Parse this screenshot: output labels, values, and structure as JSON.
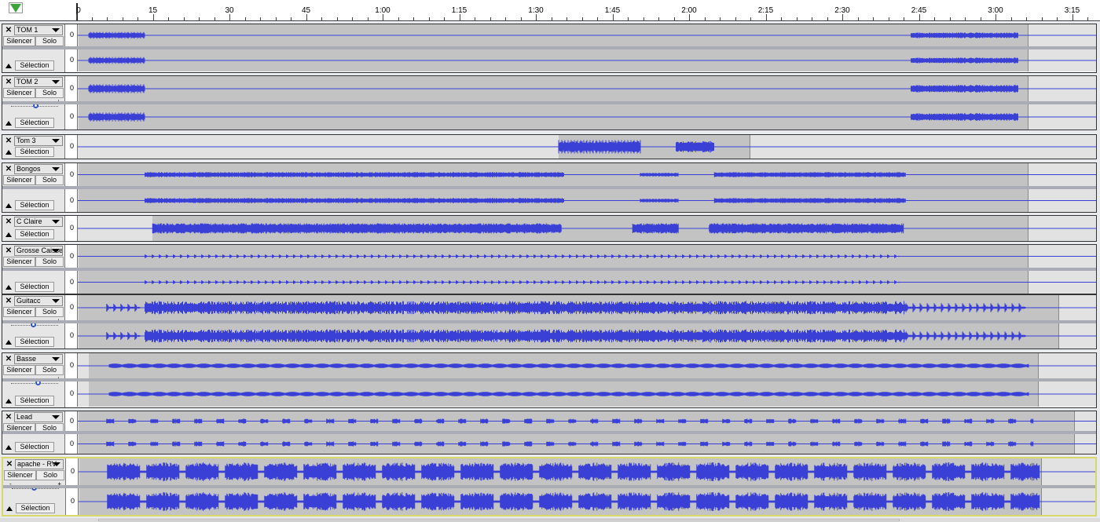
{
  "ruler": {
    "marker_icon": "play-head-triangle-icon",
    "ticks": [
      {
        "label": "0",
        "seconds": 0
      },
      {
        "label": "15",
        "seconds": 15
      },
      {
        "label": "30",
        "seconds": 30
      },
      {
        "label": "45",
        "seconds": 45
      },
      {
        "label": "1:00",
        "seconds": 60
      },
      {
        "label": "1:15",
        "seconds": 75
      },
      {
        "label": "1:30",
        "seconds": 90
      },
      {
        "label": "1:45",
        "seconds": 105
      },
      {
        "label": "2:00",
        "seconds": 120
      },
      {
        "label": "2:15",
        "seconds": 135
      },
      {
        "label": "2:30",
        "seconds": 150
      },
      {
        "label": "2:45",
        "seconds": 165
      },
      {
        "label": "3:00",
        "seconds": 180
      },
      {
        "label": "3:15",
        "seconds": 195
      }
    ]
  },
  "labels": {
    "close": "✕",
    "mute": "Silencer",
    "solo": "Solo",
    "select": "Sélection",
    "scale_zero": "0",
    "gain_minus": "-",
    "gain_plus": "+"
  },
  "colors": {
    "waveform": "#3a40d6",
    "clip_background": "#c3c3c3",
    "selected_track_border": "#d8d86a",
    "play_marker": "#3aa33a"
  },
  "tracks": [
    {
      "name": "TOM 1",
      "stereo": true,
      "has_mute_solo": true,
      "has_gain": false,
      "selected": false,
      "clip_start": 0,
      "clip_end": 186,
      "segments": [
        {
          "start": 2,
          "end": 13,
          "amp": 0.35,
          "style": "spiky"
        },
        {
          "start": 163,
          "end": 184,
          "amp": 0.35,
          "style": "spiky"
        }
      ]
    },
    {
      "name": "TOM 2",
      "stereo": true,
      "has_mute_solo": true,
      "has_gain": true,
      "gain_level": 0.5,
      "selected": false,
      "clip_start": 0,
      "clip_end": 186,
      "segments": [
        {
          "start": 2,
          "end": 13,
          "amp": 0.4,
          "style": "spiky"
        },
        {
          "start": 163,
          "end": 184,
          "amp": 0.4,
          "style": "spiky"
        }
      ]
    },
    {
      "name": "Tom 3",
      "stereo": false,
      "has_mute_solo": false,
      "has_gain": false,
      "selected": false,
      "clip_start": 94,
      "clip_end": 131.5,
      "segments": [
        {
          "start": 94,
          "end": 110,
          "amp": 0.65,
          "style": "spiky"
        },
        {
          "start": 117,
          "end": 124.5,
          "amp": 0.65,
          "style": "spiky"
        }
      ]
    },
    {
      "name": "Bongos",
      "stereo": true,
      "has_mute_solo": true,
      "has_gain": false,
      "selected": false,
      "clip_start": 0,
      "clip_end": 186,
      "segments": [
        {
          "start": 13,
          "end": 95,
          "amp": 0.3,
          "style": "spiky"
        },
        {
          "start": 110,
          "end": 117.5,
          "amp": 0.2,
          "style": "spiky"
        },
        {
          "start": 124.5,
          "end": 162,
          "amp": 0.3,
          "style": "spiky"
        }
      ]
    },
    {
      "name": "C Claire",
      "stereo": false,
      "has_mute_solo": false,
      "has_gain": false,
      "selected": false,
      "clip_start": 14.5,
      "clip_end": 186,
      "segments": [
        {
          "start": 14.5,
          "end": 94.5,
          "amp": 0.55,
          "style": "spiky"
        },
        {
          "start": 108.5,
          "end": 117.5,
          "amp": 0.55,
          "style": "spiky"
        },
        {
          "start": 123.5,
          "end": 161.5,
          "amp": 0.55,
          "style": "spiky"
        }
      ]
    },
    {
      "name": "Grosse Caisse",
      "stereo": true,
      "has_mute_solo": true,
      "has_gain": false,
      "selected": false,
      "clip_start": 0,
      "clip_end": 186,
      "segments": [
        {
          "start": 13,
          "end": 161,
          "amp": 0.2,
          "style": "pulse"
        }
      ]
    },
    {
      "name": "Guitacc",
      "stereo": true,
      "has_mute_solo": true,
      "has_gain": true,
      "gain_level": 0.45,
      "selected": false,
      "clip_start": 0,
      "clip_end": 192,
      "segments": [
        {
          "start": 5.5,
          "end": 12,
          "amp": 0.4,
          "style": "pulse"
        },
        {
          "start": 13,
          "end": 162,
          "amp": 0.6,
          "style": "dense"
        },
        {
          "start": 162,
          "end": 185.5,
          "amp": 0.45,
          "style": "pulse"
        }
      ]
    },
    {
      "name": "Basse",
      "stereo": true,
      "has_mute_solo": true,
      "has_gain": true,
      "gain_level": 0.55,
      "selected": false,
      "clip_start": 2,
      "clip_end": 188,
      "segments": [
        {
          "start": 6,
          "end": 186,
          "amp": 0.2,
          "style": "smooth"
        }
      ]
    },
    {
      "name": "Lead",
      "stereo": true,
      "has_mute_solo": true,
      "has_gain": false,
      "selected": false,
      "clip_start": 0,
      "clip_end": 195,
      "segments": [
        {
          "start": 5.5,
          "end": 187,
          "amp": 0.3,
          "style": "lead"
        }
      ]
    },
    {
      "name": "apache - RV",
      "stereo": true,
      "has_mute_solo": true,
      "has_gain": true,
      "gain_level": 0.45,
      "selected": true,
      "clip_start": 0,
      "clip_end": 188.5,
      "segments": [
        {
          "start": 5.5,
          "end": 188,
          "amp": 0.8,
          "style": "phrases"
        }
      ]
    }
  ]
}
